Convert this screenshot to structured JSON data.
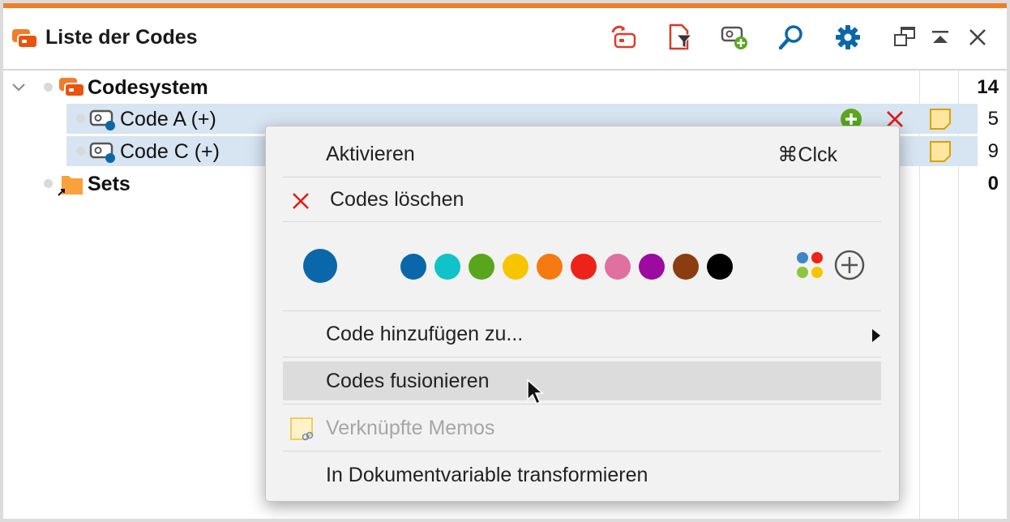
{
  "window": {
    "title": "Liste der Codes",
    "accent_color": "#f07d2a",
    "toolbar": [
      {
        "icon": "codes-refresh-icon"
      },
      {
        "icon": "document-filter-icon"
      },
      {
        "icon": "new-code-icon"
      },
      {
        "icon": "search-icon"
      },
      {
        "icon": "gear-icon"
      },
      {
        "icon": "undock-window-icon"
      },
      {
        "icon": "collapse-up-icon"
      },
      {
        "icon": "close-icon"
      }
    ]
  },
  "tree": {
    "root": {
      "label": "Codesystem",
      "count": "14"
    },
    "codes": [
      {
        "label": "Code A (+)",
        "count": "5"
      },
      {
        "label": "Code C (+)",
        "count": "9"
      }
    ],
    "sets": {
      "label": "Sets",
      "count": "0"
    }
  },
  "context_menu": {
    "activate": {
      "label": "Aktivieren",
      "shortcut": "⌘Clck"
    },
    "delete": {
      "label": "Codes löschen"
    },
    "current_color": "#0a67aa",
    "colors": [
      "#0a67aa",
      "#10c2c9",
      "#58a61c",
      "#f7c500",
      "#f57a10",
      "#ee2218",
      "#e070a0",
      "#9c0aa0",
      "#8b3c10",
      "#000000"
    ],
    "add_to": {
      "label": "Code hinzufügen zu..."
    },
    "merge": {
      "label": "Codes fusionieren"
    },
    "linked_memos": {
      "label": "Verknüpfte Memos"
    },
    "transform": {
      "label": "In Dokumentvariable transformieren"
    }
  }
}
